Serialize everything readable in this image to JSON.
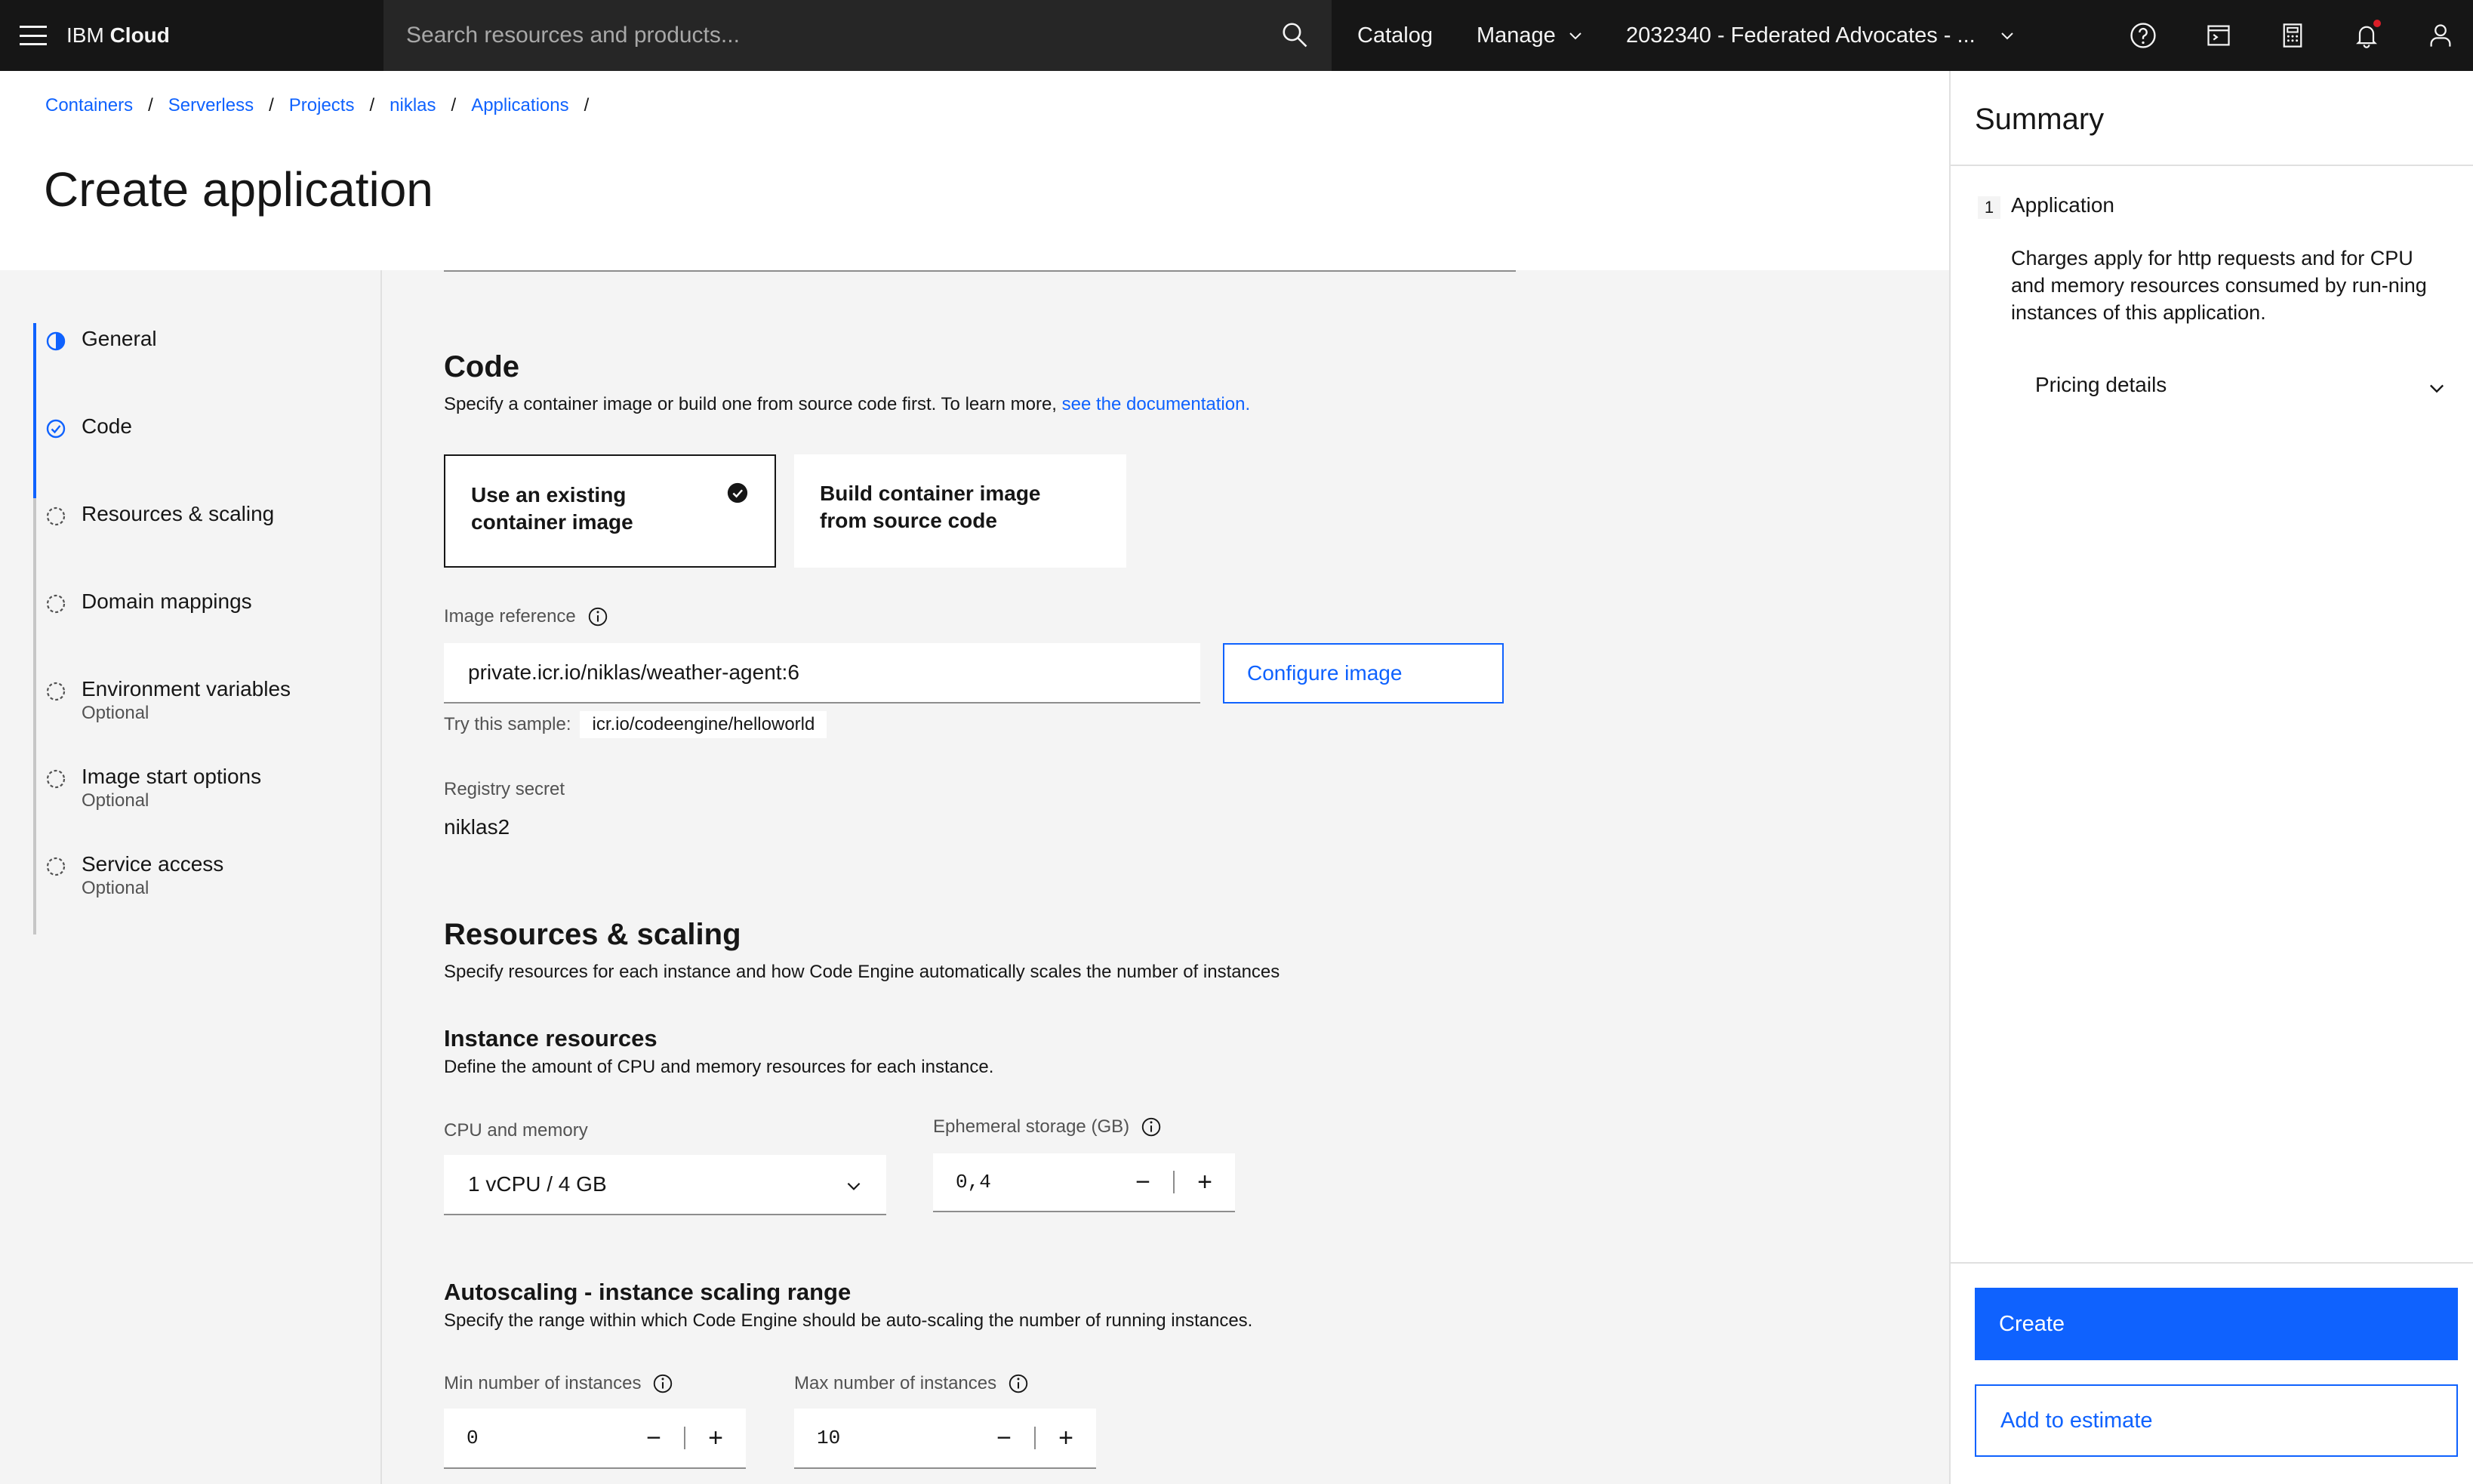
{
  "header": {
    "brand_prefix": "IBM",
    "brand_suffix": "Cloud",
    "search_placeholder": "Search resources and products...",
    "catalog": "Catalog",
    "manage": "Manage",
    "account": "2032340 - Federated Advocates - ..."
  },
  "breadcrumb": [
    "Containers",
    "Serverless",
    "Projects",
    "niklas",
    "Applications"
  ],
  "page_title": "Create application",
  "steps": [
    {
      "label": "General",
      "sub": "",
      "state": "current"
    },
    {
      "label": "Code",
      "sub": "",
      "state": "complete"
    },
    {
      "label": "Resources & scaling",
      "sub": "",
      "state": "incomplete"
    },
    {
      "label": "Domain mappings",
      "sub": "",
      "state": "incomplete"
    },
    {
      "label": "Environment variables",
      "sub": "Optional",
      "state": "incomplete"
    },
    {
      "label": "Image start options",
      "sub": "Optional",
      "state": "incomplete"
    },
    {
      "label": "Service access",
      "sub": "Optional",
      "state": "incomplete"
    }
  ],
  "code": {
    "title": "Code",
    "desc": "Specify a container image or build one from source code first. To learn more, ",
    "doc_link": "see the documentation.",
    "tile_existing_line1": "Use an existing",
    "tile_existing_line2": "container image",
    "tile_build_line1": "Build container image",
    "tile_build_line2": "from source code",
    "image_ref_label": "Image reference",
    "image_ref_value": "private.icr.io/niklas/weather-agent:6",
    "configure_image": "Configure image",
    "sample_label": "Try this sample:",
    "sample_value": "icr.io/codeengine/helloworld",
    "registry_label": "Registry secret",
    "registry_value": "niklas2"
  },
  "resources": {
    "title": "Resources & scaling",
    "desc": "Specify resources for each instance and how Code Engine automatically scales the number of instances",
    "instance_title": "Instance resources",
    "instance_desc": "Define the amount of CPU and memory resources for each instance.",
    "cpu_label": "CPU and memory",
    "cpu_value": "1 vCPU / 4 GB",
    "storage_label": "Ephemeral storage (GB)",
    "storage_value": "0,4",
    "autoscale_title": "Autoscaling - instance scaling range",
    "autoscale_desc": "Specify the range within which Code Engine should be auto-scaling the number of running instances.",
    "min_label": "Min number of instances",
    "min_value": "0",
    "max_label": "Max number of instances",
    "max_value": "10"
  },
  "summary": {
    "title": "Summary",
    "step_num": "1",
    "app_label": "Application",
    "text": "Charges apply for http requests and for CPU and memory resources consumed by run-ning instances of this application.",
    "pricing": "Pricing details",
    "create": "Create",
    "estimate": "Add to estimate"
  }
}
